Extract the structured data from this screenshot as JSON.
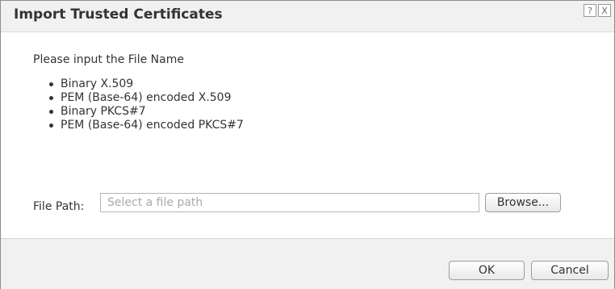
{
  "dialog": {
    "title": "Import Trusted Certificates",
    "help_glyph": "?",
    "close_glyph": "X"
  },
  "content": {
    "prompt": "Please input the File Name",
    "formats": [
      "Binary X.509",
      "PEM (Base-64) encoded X.509",
      "Binary PKCS#7",
      "PEM (Base-64) encoded PKCS#7"
    ],
    "file_path": {
      "label": "File Path:",
      "value": "",
      "placeholder": "Select a file path"
    },
    "browse_label": "Browse..."
  },
  "footer": {
    "ok_label": "OK",
    "cancel_label": "Cancel"
  },
  "icons": [
    "help-icon",
    "close-icon",
    "bullet-icon"
  ]
}
